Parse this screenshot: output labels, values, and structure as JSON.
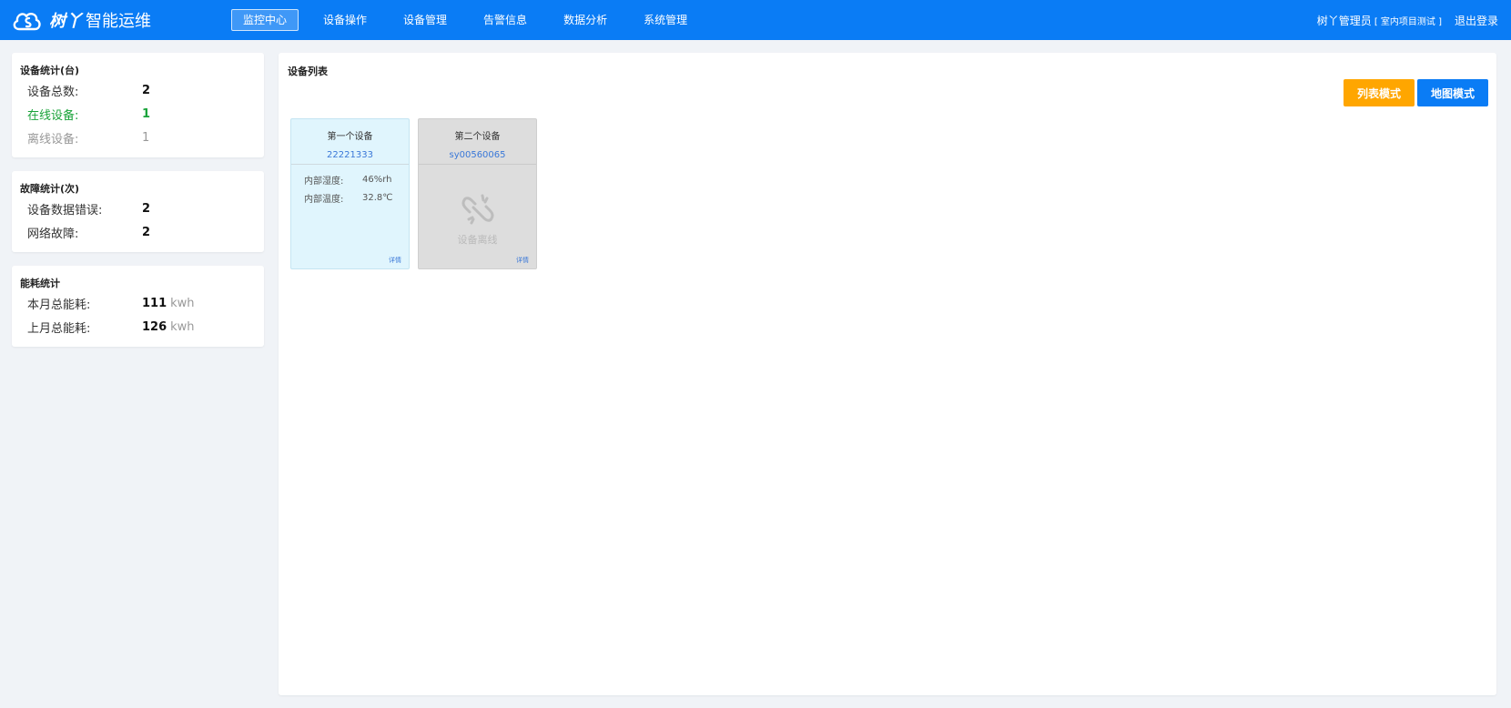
{
  "header": {
    "brand": "树丫",
    "title": "智能运维",
    "nav": [
      {
        "label": "监控中心",
        "active": true
      },
      {
        "label": "设备操作"
      },
      {
        "label": "设备管理"
      },
      {
        "label": "告警信息"
      },
      {
        "label": "数据分析"
      },
      {
        "label": "系统管理"
      }
    ],
    "user_name": "树丫管理员",
    "user_org": "[ 室内项目测试 ]",
    "logout": "退出登录"
  },
  "device_stats": {
    "title": "设备统计(台)",
    "rows": [
      {
        "label": "设备总数:",
        "value": "2"
      },
      {
        "label": "在线设备:",
        "value": "1"
      },
      {
        "label": "离线设备:",
        "value": "1"
      }
    ]
  },
  "fault_stats": {
    "title": "故障统计(次)",
    "rows": [
      {
        "label": "设备数据错误:",
        "value": "2"
      },
      {
        "label": "网络故障:",
        "value": "2"
      }
    ]
  },
  "energy_stats": {
    "title": "能耗统计",
    "rows": [
      {
        "label": "本月总能耗:",
        "value": "111",
        "unit": "kwh"
      },
      {
        "label": "上月总能耗:",
        "value": "126",
        "unit": "kwh"
      }
    ]
  },
  "device_list": {
    "title": "设备列表",
    "list_mode": "列表模式",
    "map_mode": "地图模式",
    "devices": [
      {
        "name": "第一个设备",
        "sn": "22221333",
        "params": [
          {
            "label": "内部湿度:",
            "value": "46%rh"
          },
          {
            "label": "内部温度:",
            "value": "32.8℃"
          }
        ],
        "detail": "详情"
      },
      {
        "name": "第二个设备",
        "sn": "sy00560065",
        "status_text": "设备离线",
        "detail": "详情"
      }
    ]
  },
  "colors": {
    "primary": "#0a7cf5",
    "accent": "#ffa600",
    "online": "#1aa33a",
    "online_card": "#e0f5fd",
    "offline_card": "#dddddd"
  }
}
